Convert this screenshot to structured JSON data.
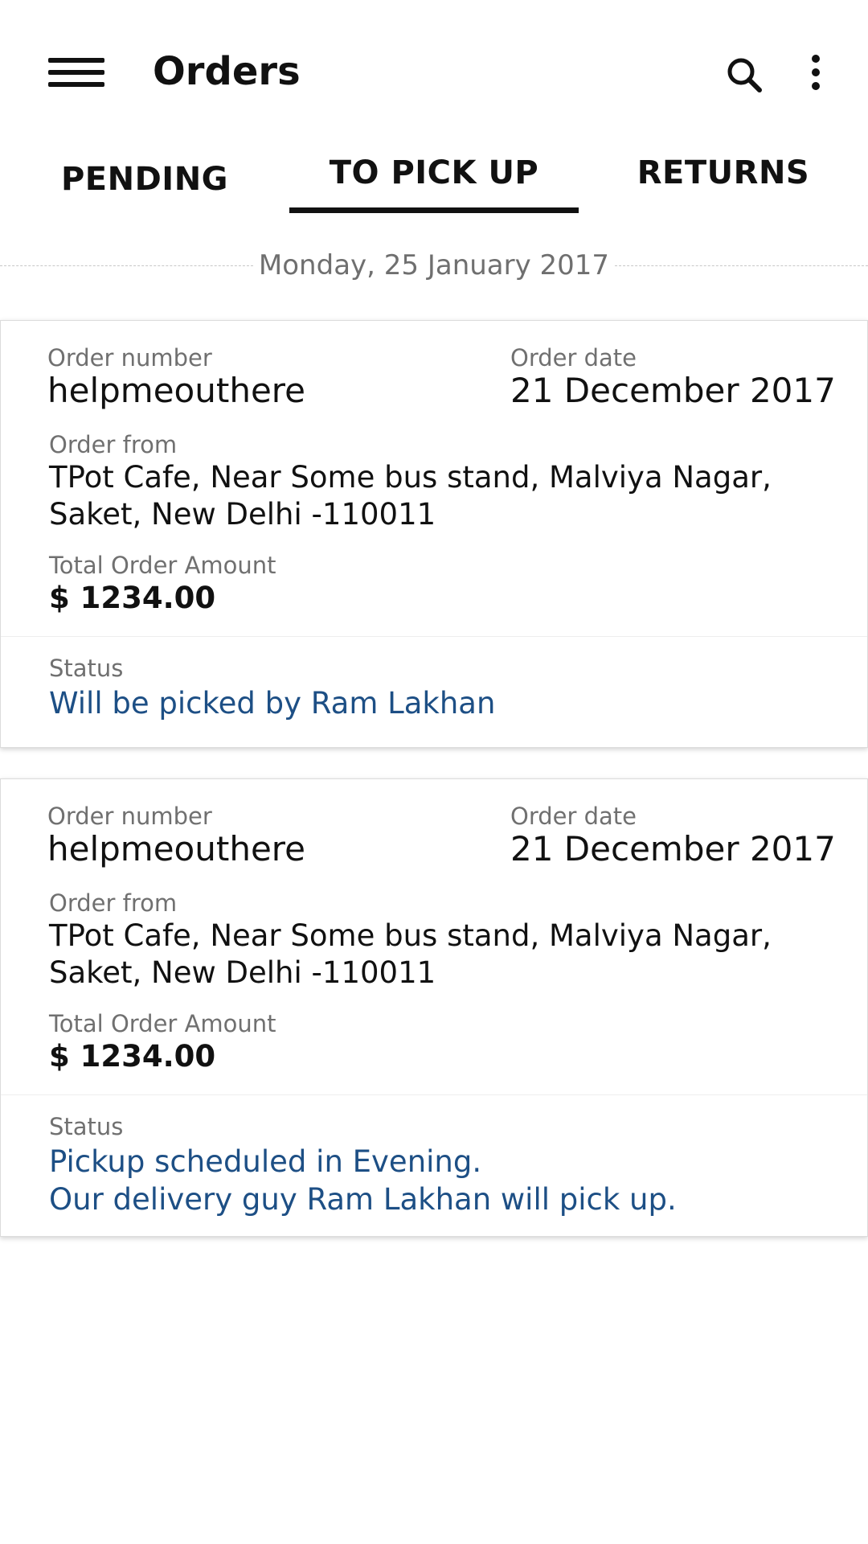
{
  "header": {
    "title": "Orders"
  },
  "tabs": [
    {
      "label": "PENDING"
    },
    {
      "label": "TO PICK UP",
      "active": true
    },
    {
      "label": "RETURNS"
    }
  ],
  "date_group": "Monday, 25 January 2017",
  "labels": {
    "order_number": "Order number",
    "order_date": "Order date",
    "order_from": "Order from",
    "total_amount": "Total Order Amount",
    "status": "Status"
  },
  "orders": [
    {
      "order_number": "helpmeouthere",
      "order_date": "21 December 2017",
      "order_from_line1": "TPot Cafe, Near Some bus stand, Malviya Nagar,",
      "order_from_line2": "Saket, New Delhi -110011",
      "total_amount": "$ 1234.00",
      "status_line1": "Will be picked by Ram Lakhan",
      "status_line2": ""
    },
    {
      "order_number": "helpmeouthere",
      "order_date": "21 December 2017",
      "order_from_line1": "TPot Cafe, Near Some bus stand, Malviya Nagar,",
      "order_from_line2": "Saket, New Delhi -110011",
      "total_amount": "$ 1234.00",
      "status_line1": "Pickup scheduled in Evening.",
      "status_line2": "Our delivery guy Ram Lakhan will pick up."
    }
  ],
  "colors": {
    "status_text": "#1d4f85",
    "label_text": "#707070",
    "primary_text": "#111111"
  },
  "icons": {
    "menu": "menu-icon",
    "search": "search-icon",
    "more": "more-vertical-icon"
  }
}
